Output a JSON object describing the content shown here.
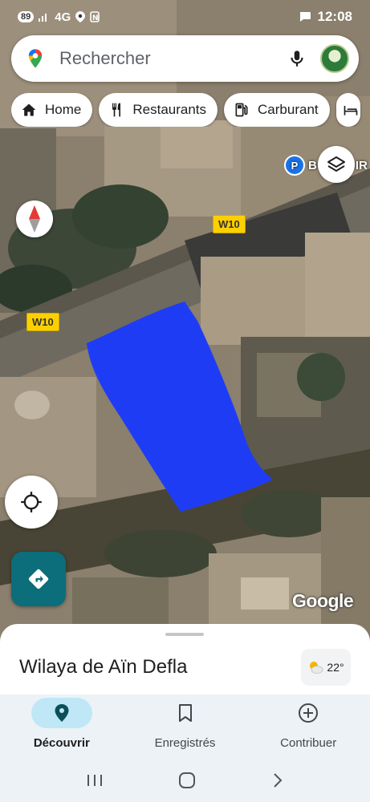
{
  "status_bar": {
    "battery": "89",
    "network": "4G",
    "network_sub": "LTE",
    "time": "12:08"
  },
  "search": {
    "placeholder": "Rechercher"
  },
  "chips": [
    {
      "label": "Home",
      "icon": "home-icon"
    },
    {
      "label": "Restaurants",
      "icon": "restaurant-icon"
    },
    {
      "label": "Carburant",
      "icon": "fuel-icon"
    }
  ],
  "map": {
    "road_labels": [
      "W10",
      "W10"
    ],
    "poi_label": "B",
    "poi_label_tail": "IR",
    "attribution": "Google",
    "highlight_color": "#1f3cf5"
  },
  "sheet": {
    "title": "Wilaya de Aïn Defla",
    "temperature": "22°"
  },
  "nav": [
    {
      "label": "Découvrir",
      "icon": "explore-pin-icon",
      "active": true
    },
    {
      "label": "Enregistrés",
      "icon": "bookmark-icon",
      "active": false
    },
    {
      "label": "Contribuer",
      "icon": "add-circle-icon",
      "active": false
    }
  ],
  "colors": {
    "accent": "#0b6e7a",
    "active_nav_bg": "#bfe7f6"
  }
}
